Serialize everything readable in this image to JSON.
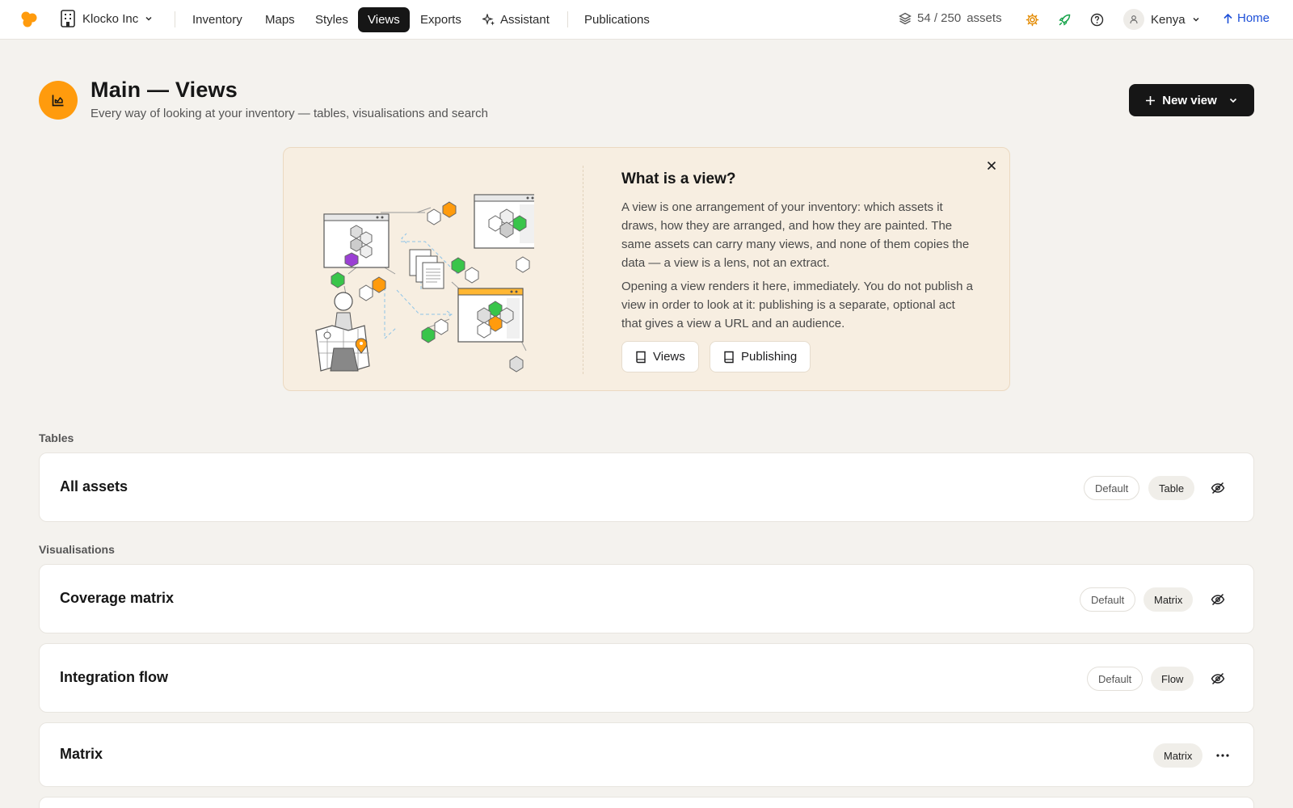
{
  "topbar": {
    "org_name": "Klocko Inc",
    "nav": [
      {
        "label": "Inventory"
      },
      {
        "label": "Maps"
      },
      {
        "label": "Styles"
      },
      {
        "label": "Views"
      },
      {
        "label": "Exports"
      },
      {
        "label": "Assistant"
      },
      {
        "label": "Publications"
      }
    ],
    "active_tab": "Views",
    "assets_count": "54 / 250",
    "assets_label": "assets",
    "user_name": "Kenya",
    "home_label": "Home",
    "accent_color": "#ff9b0d",
    "link_color": "#1c4fd8"
  },
  "header": {
    "title": "Main — Views",
    "subtitle": "Every way of looking at your inventory — tables, visualisations and search",
    "new_view_label": "New view"
  },
  "info": {
    "title": "What is a view?",
    "p1": "A view is one arrangement of your inventory: which assets it draws, how they are arranged, and how they are painted. The same assets can carry many views, and none of them copies the data — a view is a lens, not an extract.",
    "p2": "Opening a view renders it here, immediately. You do not publish a view in order to look at it: publishing is a separate, optional act that gives a view a URL and an audience.",
    "btn_views": "Views",
    "btn_publishing": "Publishing"
  },
  "sections": {
    "tables_label": "Tables",
    "visualisations_label": "Visualisations"
  },
  "views": [
    {
      "name": "All assets",
      "default_badge": "Default",
      "type": "Table"
    },
    {
      "name": "Coverage matrix",
      "default_badge": "Default",
      "type": "Matrix"
    },
    {
      "name": "Integration flow",
      "default_badge": "Default",
      "type": "Flow"
    },
    {
      "name": "Matrix",
      "type": "Matrix"
    }
  ]
}
